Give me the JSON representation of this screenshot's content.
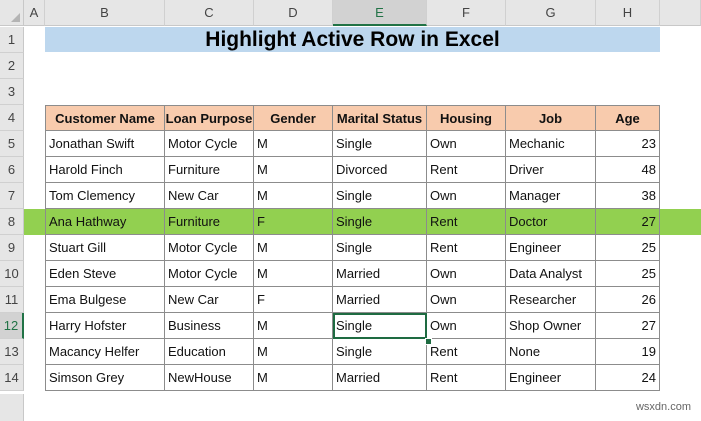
{
  "columns": [
    "A",
    "B",
    "C",
    "D",
    "E",
    "F",
    "G",
    "H"
  ],
  "rows": [
    "1",
    "2",
    "3",
    "4",
    "5",
    "6",
    "7",
    "8",
    "9",
    "10",
    "11",
    "12",
    "13",
    "14"
  ],
  "selected_column": "E",
  "selected_row": "12",
  "title": "Highlight Active Row in Excel",
  "table": {
    "headers": [
      "Customer Name",
      "Loan Purpose",
      "Gender",
      "Marital Status",
      "Housing",
      "Job",
      "Age"
    ],
    "rows": [
      [
        "Jonathan Swift",
        "Motor Cycle",
        "M",
        "Single",
        "Own",
        "Mechanic",
        "23"
      ],
      [
        "Harold Finch",
        "Furniture",
        "M",
        "Divorced",
        "Rent",
        "Driver",
        "48"
      ],
      [
        "Tom Clemency",
        "New Car",
        "M",
        "Single",
        "Own",
        "Manager",
        "38"
      ],
      [
        "Ana Hathway",
        "Furniture",
        "F",
        "Single",
        "Rent",
        "Doctor",
        "27"
      ],
      [
        "Stuart Gill",
        "Motor Cycle",
        "M",
        "Single",
        "Rent",
        "Engineer",
        "25"
      ],
      [
        "Eden Steve",
        "Motor Cycle",
        "M",
        "Married",
        "Own",
        "Data Analyst",
        "25"
      ],
      [
        "Ema Bulgese",
        "New Car",
        "F",
        "Married",
        "Own",
        "Researcher",
        "26"
      ],
      [
        "Harry Hofster",
        "Business",
        "M",
        "Single",
        "Own",
        "Shop Owner",
        "27"
      ],
      [
        "Macancy Helfer",
        "Education",
        "M",
        "Single",
        "Rent",
        "None",
        "19"
      ],
      [
        "Simson Grey",
        "NewHouse",
        "M",
        "Married",
        "Rent",
        "Engineer",
        "24"
      ]
    ]
  },
  "highlighted_row_color": "#92d050",
  "header_fill": "#f8cbad",
  "title_fill": "#bdd7ee",
  "watermark": "wsxdn.com"
}
